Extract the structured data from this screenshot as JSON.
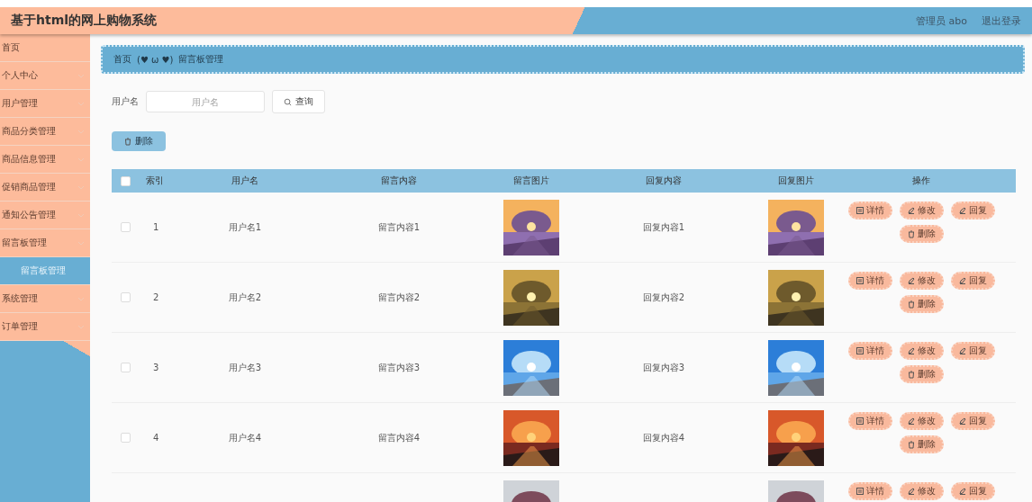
{
  "header": {
    "title": "基于html的网上购物系统",
    "user": "管理员 abo",
    "logout": "退出登录"
  },
  "sidebar": {
    "items": [
      {
        "kind": "link",
        "label": "首页"
      },
      {
        "kind": "menu",
        "label": "个人中心"
      },
      {
        "kind": "menu",
        "label": "用户管理"
      },
      {
        "kind": "menu",
        "label": "商品分类管理"
      },
      {
        "kind": "menu",
        "label": "商品信息管理"
      },
      {
        "kind": "menu",
        "label": "促销商品管理"
      },
      {
        "kind": "menu",
        "label": "通知公告管理"
      },
      {
        "kind": "menu",
        "label": "留言板管理",
        "children": [
          {
            "label": "留言板管理",
            "selected": true
          }
        ]
      },
      {
        "kind": "menu",
        "label": "系统管理"
      },
      {
        "kind": "menu",
        "label": "订单管理"
      }
    ]
  },
  "breadcrumb": {
    "home": "首页",
    "separator": "(♥ ω ♥)",
    "current": "留言板管理"
  },
  "search": {
    "label": "用户名",
    "placeholder": "用户名",
    "button": "查询"
  },
  "delete_button": "删除",
  "table": {
    "all_checked": false,
    "columns": [
      "索引",
      "用户名",
      "留言内容",
      "留言图片",
      "回复内容",
      "回复图片",
      "操作"
    ],
    "rows": [
      {
        "checked": false,
        "index": "1",
        "user": "用户名1",
        "content": "留言内容1",
        "reply": "回复内容1",
        "actions": [
          "详情",
          "修改",
          "回复",
          "删除"
        ]
      },
      {
        "checked": false,
        "index": "2",
        "user": "用户名2",
        "content": "留言内容2",
        "reply": "回复内容2",
        "actions": [
          "详情",
          "修改",
          "回复",
          "删除"
        ]
      },
      {
        "checked": false,
        "index": "3",
        "user": "用户名3",
        "content": "留言内容3",
        "reply": "回复内容3",
        "actions": [
          "详情",
          "修改",
          "回复",
          "删除"
        ]
      },
      {
        "checked": false,
        "index": "4",
        "user": "用户名4",
        "content": "留言内容4",
        "reply": "回复内容4",
        "actions": [
          "详情",
          "修改",
          "回复",
          "删除"
        ]
      },
      {
        "actions": [
          "详情",
          "修改",
          "回复"
        ]
      }
    ]
  }
}
